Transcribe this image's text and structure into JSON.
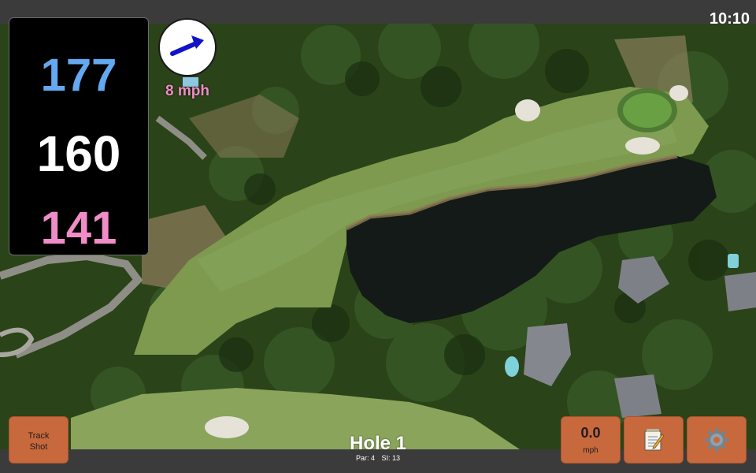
{
  "status_bar": {
    "time": "10:10"
  },
  "distances": {
    "back": "177",
    "middle": "160",
    "front": "141",
    "colors": {
      "back": "#64a8f0",
      "middle": "#ffffff",
      "front": "#f08cc8"
    }
  },
  "wind": {
    "speed_label": "8 mph",
    "arrow_color": "#1212c8",
    "label_color": "#f08cc8"
  },
  "buttons": {
    "track_shot_line1": "Track",
    "track_shot_line2": "Shot",
    "speed_value": "0.0",
    "speed_unit": "mph",
    "notes_icon": "notepad-icon",
    "settings_icon": "gear-icon",
    "accent": "#c8693d"
  },
  "hole": {
    "title": "Hole 1",
    "par_label": "Par: 4",
    "si_label": "SI: 13"
  }
}
